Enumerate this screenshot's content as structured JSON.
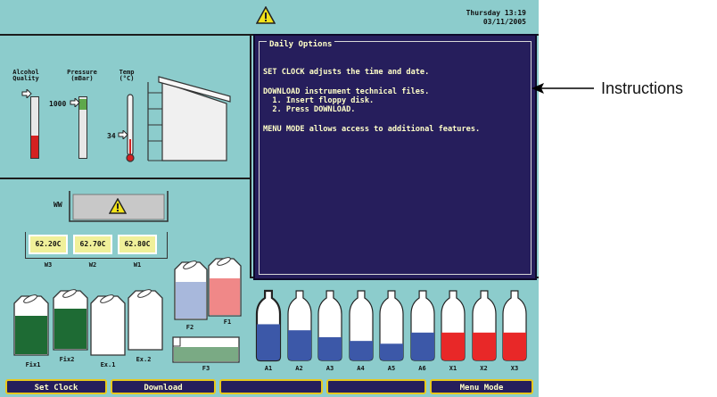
{
  "header": {
    "warning_icon": "warning-triangle-icon",
    "datetime_line1": "Thursday 13:19",
    "datetime_line2": "03/11/2005"
  },
  "gauges": {
    "alcohol_label_1": "Alcohol",
    "alcohol_label_2": "Quality",
    "pressure_label_1": "Pressure",
    "pressure_label_2": "(mBar)",
    "temp_label_1": "Temp",
    "temp_label_2": "(°C)",
    "pressure_value": "1000",
    "temp_value": "34"
  },
  "ww_label": "WW",
  "waxbaths": [
    {
      "temp": "62.20C",
      "name": "W3"
    },
    {
      "temp": "62.70C",
      "name": "W2"
    },
    {
      "temp": "62.80C",
      "name": "W1"
    }
  ],
  "reagents": {
    "fixatives": [
      "Fix1",
      "Fix2"
    ],
    "ex": [
      "Ex.1",
      "Ex.2"
    ],
    "f1": "F1",
    "f2": "F2",
    "f3": "F3"
  },
  "bottles": [
    {
      "name": "A1",
      "color": "#3c58a8",
      "level": 0.78
    },
    {
      "name": "A2",
      "color": "#3c58a8",
      "level": 0.65
    },
    {
      "name": "A3",
      "color": "#3c58a8",
      "level": 0.5
    },
    {
      "name": "A4",
      "color": "#3c58a8",
      "level": 0.42
    },
    {
      "name": "A5",
      "color": "#3c58a8",
      "level": 0.36
    },
    {
      "name": "A6",
      "color": "#3c58a8",
      "level": 0.6
    },
    {
      "name": "X1",
      "color": "#e82828",
      "level": 0.6
    },
    {
      "name": "X2",
      "color": "#e82828",
      "level": 0.6
    },
    {
      "name": "X3",
      "color": "#e82828",
      "level": 0.6
    }
  ],
  "info_panel": {
    "title": "Daily Options",
    "line1": "SET CLOCK adjusts the time and date.",
    "line2": "DOWNLOAD instrument technical files.",
    "line3": "  1. Insert floppy disk.",
    "line4": "  2. Press DOWNLOAD.",
    "line5": "MENU MODE allows access to additional features."
  },
  "buttons": {
    "set_clock": "Set Clock",
    "download": "Download",
    "blank1": "",
    "blank2": "",
    "menu_mode": "Menu Mode"
  },
  "annotation": {
    "label": "Instructions"
  },
  "colors": {
    "screen_bg": "#8ccccc",
    "panel_bg": "#261e5c",
    "panel_text": "#ffffc8",
    "button_border": "#e8c81c",
    "reagent_blue": "#3c58a8",
    "reagent_red": "#e82828",
    "fix_green": "#1e6b34",
    "wax_yellow": "#f0f09a"
  }
}
